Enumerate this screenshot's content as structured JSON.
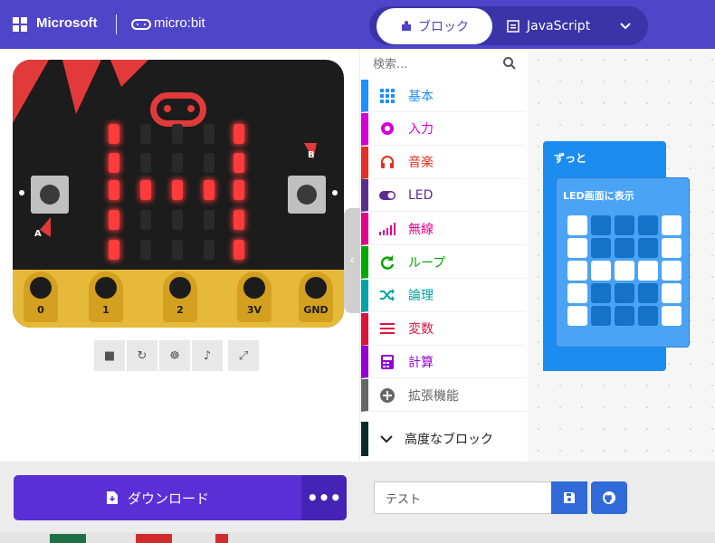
{
  "header": {
    "brand": "Microsoft",
    "product": "micro:bit",
    "tabs": {
      "blocks": "ブロック",
      "javascript": "JavaScript"
    }
  },
  "simulator": {
    "pins": [
      "0",
      "1",
      "2",
      "3V",
      "GND"
    ],
    "button_a": "A",
    "button_b": "B",
    "led_matrix": [
      [
        1,
        0,
        0,
        0,
        1
      ],
      [
        1,
        0,
        0,
        0,
        1
      ],
      [
        1,
        1,
        1,
        1,
        1
      ],
      [
        1,
        0,
        0,
        0,
        1
      ],
      [
        1,
        0,
        0,
        0,
        1
      ]
    ]
  },
  "toolbox": {
    "search_placeholder": "検索...",
    "categories": [
      {
        "label": "基本",
        "color": "#1e90ff",
        "icon": "grid-icon"
      },
      {
        "label": "入力",
        "color": "#d400d4",
        "icon": "circle-icon"
      },
      {
        "label": "音楽",
        "color": "#e63022",
        "icon": "headphones-icon"
      },
      {
        "label": "LED",
        "color": "#5c2d91",
        "icon": "toggle-icon"
      },
      {
        "label": "無線",
        "color": "#e3008c",
        "icon": "signal-icon"
      },
      {
        "label": "ループ",
        "color": "#00aa00",
        "icon": "loop-icon"
      },
      {
        "label": "論理",
        "color": "#00a4a6",
        "icon": "shuffle-icon"
      },
      {
        "label": "変数",
        "color": "#dc143c",
        "icon": "list-icon"
      },
      {
        "label": "計算",
        "color": "#9400d3",
        "icon": "calculator-icon"
      },
      {
        "label": "拡張機能",
        "color": "#666666",
        "icon": "plus-circle-icon"
      }
    ],
    "advanced": "高度なブロック"
  },
  "workspace": {
    "forever_label": "ずっと",
    "show_leds_label": "LED画面に表示",
    "led_grid": [
      [
        1,
        0,
        0,
        0,
        1
      ],
      [
        1,
        0,
        0,
        0,
        1
      ],
      [
        1,
        1,
        1,
        1,
        1
      ],
      [
        1,
        0,
        0,
        0,
        1
      ],
      [
        1,
        0,
        0,
        0,
        1
      ]
    ]
  },
  "bottom": {
    "download_label": "ダウンロード",
    "more_label": "•••",
    "project_name": "テスト"
  }
}
